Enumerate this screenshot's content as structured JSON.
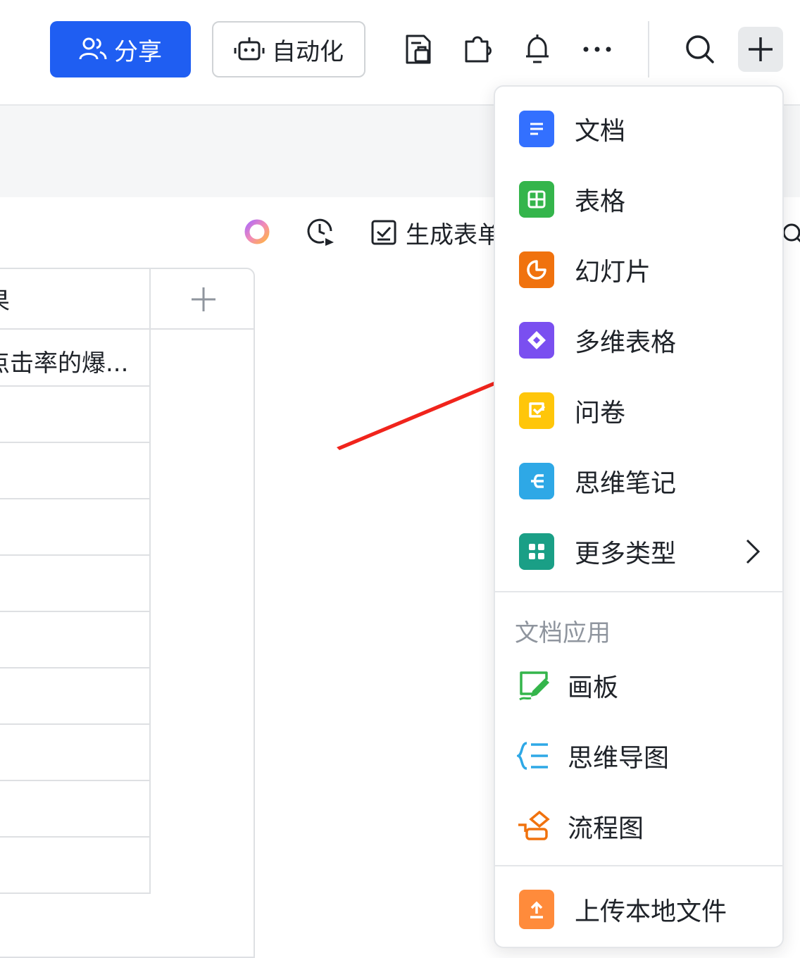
{
  "toolbar": {
    "share_label": "分享",
    "automation_label": "自动化",
    "icons": [
      "form-icon",
      "plugin-icon",
      "bell-icon",
      "more-icon",
      "search-icon",
      "plus-icon"
    ]
  },
  "subtoolbar": {
    "generate_form_label": "生成表单"
  },
  "table": {
    "header_partial": "果",
    "first_cell": "点击率的爆..."
  },
  "dropdown": {
    "items": [
      {
        "label": "文档",
        "icon": "doc-icon",
        "color": "#3370ff"
      },
      {
        "label": "表格",
        "icon": "sheet-icon",
        "color": "#34b54b"
      },
      {
        "label": "幻灯片",
        "icon": "slides-icon",
        "color": "#f0720e"
      },
      {
        "label": "多维表格",
        "icon": "bitable-icon",
        "color": "#7a4ff0"
      },
      {
        "label": "问卷",
        "icon": "survey-icon",
        "color": "#ffc60a"
      },
      {
        "label": "思维笔记",
        "icon": "mindnote-icon",
        "color": "#2ea8e6"
      },
      {
        "label": "更多类型",
        "icon": "more-types-icon",
        "color": "#1a9f86"
      }
    ],
    "section_title": "文档应用",
    "apps": [
      {
        "label": "画板",
        "icon": "whiteboard-icon",
        "color": "#34b54b"
      },
      {
        "label": "思维导图",
        "icon": "mindmap-icon",
        "color": "#2ea8e6"
      },
      {
        "label": "流程图",
        "icon": "flowchart-icon",
        "color": "#f0720e"
      }
    ],
    "upload_label": "上传本地文件",
    "upload_color": "#ff8b3b"
  },
  "annotation": {
    "arrow_color": "#f0241c"
  }
}
